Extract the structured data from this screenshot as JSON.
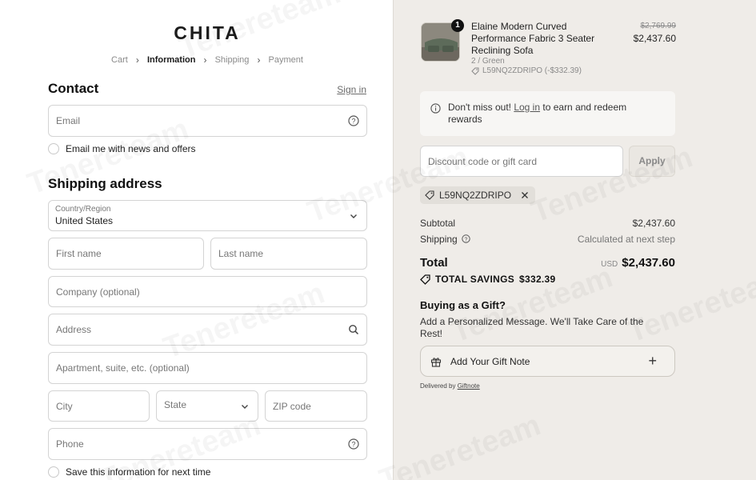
{
  "brand": {
    "logo": "CHITA"
  },
  "breadcrumb": [
    {
      "label": "Cart",
      "active": false
    },
    {
      "label": "Information",
      "active": true
    },
    {
      "label": "Shipping",
      "active": false
    },
    {
      "label": "Payment",
      "active": false
    }
  ],
  "contact": {
    "heading": "Contact",
    "sign_in": "Sign in",
    "email_placeholder": "Email",
    "newsletter_label": "Email me with news and offers"
  },
  "shipping": {
    "heading": "Shipping address",
    "country_label": "Country/Region",
    "country_value": "United States",
    "first_name": "First name",
    "last_name": "Last name",
    "company": "Company (optional)",
    "address": "Address",
    "apartment": "Apartment, suite, etc. (optional)",
    "city": "City",
    "state": "State",
    "zip": "ZIP code",
    "phone": "Phone",
    "save_info": "Save this information for next time"
  },
  "summary": {
    "item": {
      "quantity": "1",
      "name": "Elaine Modern Curved Performance Fabric 3 Seater Reclining Sofa",
      "variant": "2 / Green",
      "discount": "L59NQ2ZDRIPO (-$332.39)",
      "original_price": "$2,769.99",
      "price": "$2,437.60"
    },
    "notice": {
      "prefix": "Don't miss out!",
      "link": "Log in",
      "suffix": "to earn and redeem rewards"
    },
    "discount_placeholder": "Discount code or gift card",
    "apply": "Apply",
    "applied_code": "L59NQ2ZDRIPO",
    "subtotal_label": "Subtotal",
    "subtotal_value": "$2,437.60",
    "shipping_label": "Shipping",
    "shipping_value": "Calculated at next step",
    "total_label": "Total",
    "currency": "USD",
    "total_value": "$2,437.60",
    "savings_label": "TOTAL SAVINGS",
    "savings_value": "$332.39"
  },
  "gift": {
    "title": "Buying as a Gift?",
    "description": "Add a Personalized Message. We'll Take Care of the Rest!",
    "button": "Add Your Gift Note",
    "delivered_by": "Delivered by",
    "provider": "Giftnote"
  },
  "watermark": "Tenereteam"
}
